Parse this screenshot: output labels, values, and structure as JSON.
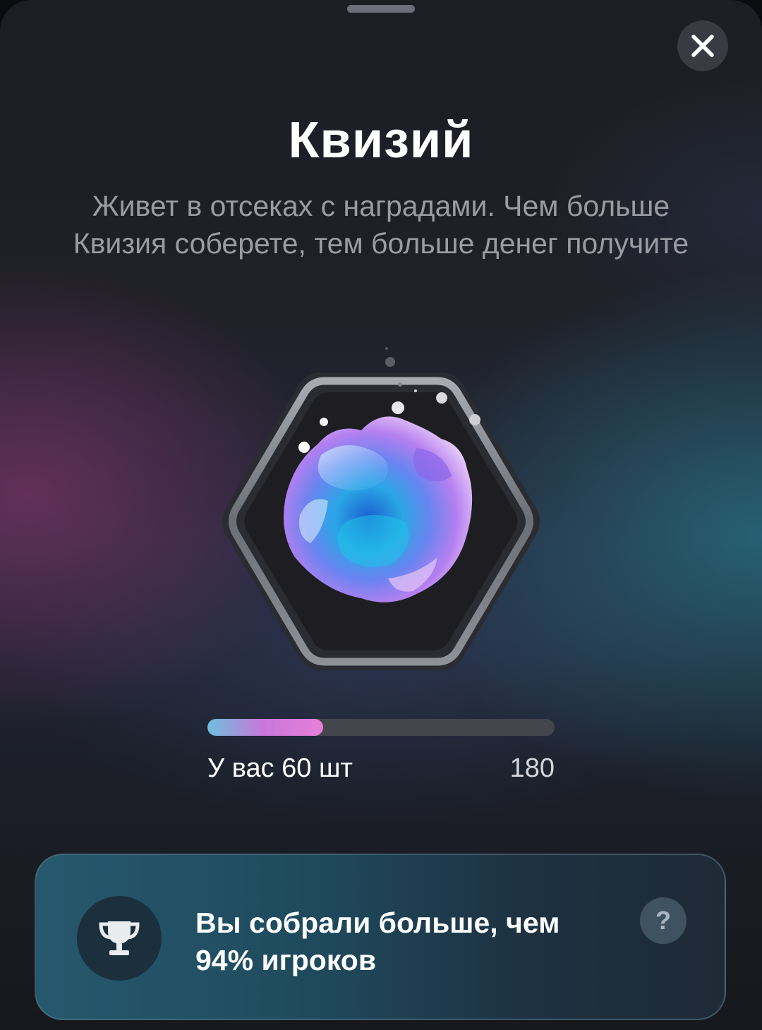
{
  "sheet": {
    "title": "Квизий",
    "description": "Живет в отсеках с наградами. Чем больше Квизия соберете, тем больше денег получите",
    "close_icon": "close-icon",
    "item_icon": "iridescent-crystal-icon"
  },
  "progress": {
    "current": 60,
    "max": 180,
    "fraction": 0.333,
    "have_label": "У вас 60 шт",
    "max_label": "180",
    "fill_colors": [
      "#6cc0de",
      "#c877d9",
      "#e77fd9"
    ]
  },
  "rank_card": {
    "text": "Вы собрали больше, чем 94% игроков",
    "trophy_icon": "trophy-icon",
    "help_label": "?"
  }
}
